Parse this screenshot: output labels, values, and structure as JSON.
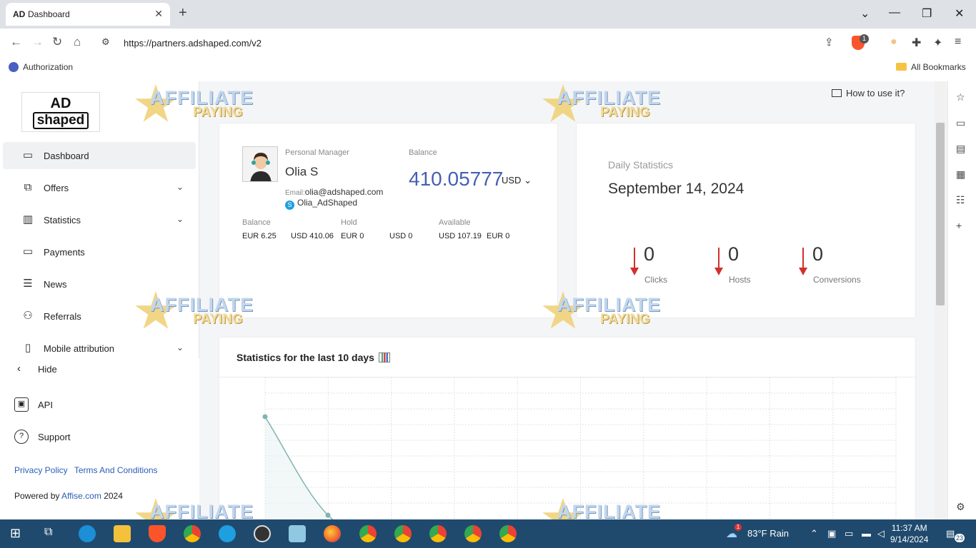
{
  "browser": {
    "tab_title": "Dashboard",
    "tab_favicon": "AD",
    "url": "https://partners.adshaped.com/v2",
    "brave_badge": "1",
    "bookmarks": {
      "left": "Authorization",
      "right": "All Bookmarks"
    }
  },
  "sidebar": {
    "logo_top": "AD",
    "logo_bottom": "shaped",
    "items": [
      {
        "label": "Dashboard",
        "icon": "monitor-icon"
      },
      {
        "label": "Offers",
        "icon": "offers-icon"
      },
      {
        "label": "Statistics",
        "icon": "bar-chart-icon"
      },
      {
        "label": "Payments",
        "icon": "wallet-icon"
      },
      {
        "label": "News",
        "icon": "news-icon"
      },
      {
        "label": "Referrals",
        "icon": "referrals-icon"
      },
      {
        "label": "Mobile attribution",
        "icon": "mobile-icon"
      }
    ],
    "hide_label": "Hide",
    "api_label": "API",
    "support_label": "Support",
    "privacy_label": "Privacy Policy",
    "terms_label": "Terms And Conditions",
    "powered_prefix": "Powered by",
    "powered_link": "Affise.com",
    "powered_year": "2024"
  },
  "main": {
    "how_to": "How to use it?",
    "manager": {
      "section_label": "Personal Manager",
      "name": "Olia S",
      "email_label": "Email:",
      "email": "olia@adshaped.com",
      "skype": "Olia_AdShaped"
    },
    "balance": {
      "label": "Balance",
      "amount": "410.05777",
      "currency": "USD"
    },
    "breakdown": {
      "balance_label": "Balance",
      "balance_eur": "EUR 6.25",
      "balance_usd": "USD 410.06",
      "hold_label": "Hold",
      "hold_eur": "EUR 0",
      "hold_usd": "USD 0",
      "available_label": "Available",
      "available_usd": "USD 107.19",
      "available_eur": "EUR 0"
    },
    "daily": {
      "title": "Daily Statistics",
      "date": "September 14, 2024",
      "stats": [
        {
          "value": "0",
          "label": "Clicks"
        },
        {
          "value": "0",
          "label": "Hosts"
        },
        {
          "value": "0",
          "label": "Conversions"
        }
      ]
    },
    "chart": {
      "title": "Statistics for the last 10 days"
    }
  },
  "watermark": {
    "line1": "AFFILIATE",
    "line2": "PAYING"
  },
  "taskbar": {
    "weather": "83°F  Rain",
    "time": "11:37 AM",
    "date": "9/14/2024",
    "notif_count": "23",
    "weather_badge": "1"
  },
  "colors": {
    "accent": "#4560b3",
    "link": "#2b5db8",
    "arrow_down": "#d0312d",
    "chart_line": "#7fb5b0",
    "taskbar": "#1f4a6e"
  }
}
